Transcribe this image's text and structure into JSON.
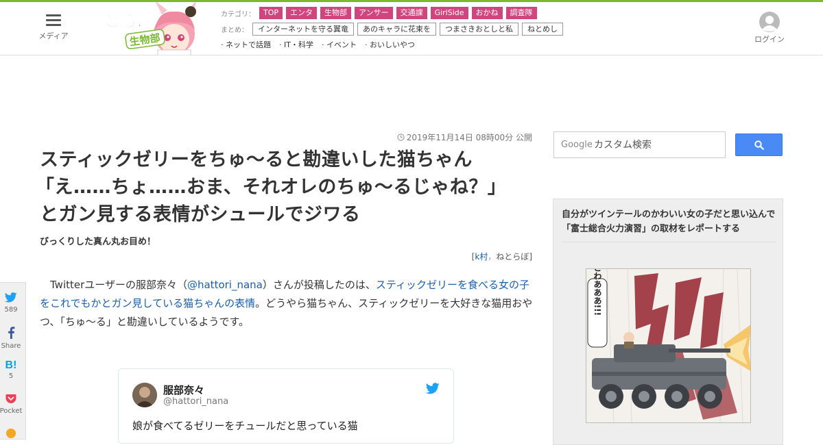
{
  "header": {
    "menu_label": "メディア",
    "category_label": "カテゴリ：",
    "categories": [
      "TOP",
      "エンタ",
      "生物部",
      "アンサー",
      "交通課",
      "GirlSide",
      "おかね",
      "調査隊"
    ],
    "matome_label": "まとめ：",
    "matome": [
      "インターネットを守る翼竜",
      "あのキャラに花束を",
      "つまさきおとしと私",
      "ねとめし"
    ],
    "sub_links": [
      "· ネットで話題",
      "· IT・科学",
      "· イベント",
      "· おいしいやつ"
    ],
    "login_label": "ログイン",
    "brand_colors": {
      "accent_bar": "#7ab82d",
      "category_tag": "#d1457f"
    }
  },
  "article": {
    "date": "2019年11月14日 08時00分 公開",
    "title_lines": [
      "スティックゼリーをちゅ～ると勘違いした猫ちゃん",
      "「え……ちょ……おま、それオレのちゅ～るじゃね？」",
      "とガン見する表情がシュールでジワる"
    ],
    "subtitle": "びっくりした真ん丸お目め！",
    "byline_open": "[",
    "byline_author": "k村",
    "byline_sep": "，",
    "byline_site": "ねとらぼ",
    "byline_close": "]",
    "body_part1": "Twitterユーザーの服部奈々（",
    "body_link1": "@hattori_nana",
    "body_part2": "）さんが投稿したのは、",
    "body_link2": "スティックゼリーを食べる女の子をこれでもかとガン見している猫ちゃんの表情",
    "body_part3": "。どうやら猫ちゃん、スティックゼリーを大好きな猫用おやつ、「ちゅ～る」と勘違いしているようです。"
  },
  "tweet": {
    "name": "服部奈々",
    "handle": "@hattori_nana",
    "text": "娘が食べてるゼリーをチュールだと思っている猫"
  },
  "share": {
    "twitter_count": "589",
    "facebook_label": "Share",
    "hatena_count": "5",
    "pocket_label": "Pocket"
  },
  "sidebar": {
    "search_placeholder": "カスタム検索",
    "google_label": "Google",
    "feature_title": "自分がツインテールのかわいい女の子だと思い込んで「富士総合火力演習」の取材をレポートする",
    "feature_image_caption": "どわあああ!!!"
  }
}
